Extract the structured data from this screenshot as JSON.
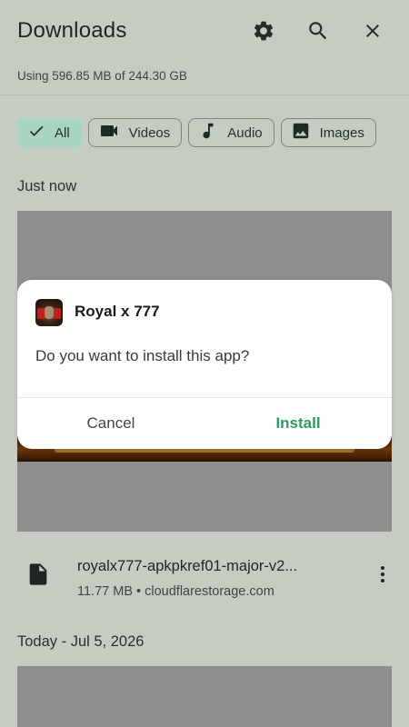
{
  "header": {
    "title": "Downloads",
    "storage_text": "Using 596.85 MB of 244.30 GB"
  },
  "filters": [
    {
      "label": "All",
      "icon": "check-icon",
      "selected": true
    },
    {
      "label": "Videos",
      "icon": "video-icon",
      "selected": false
    },
    {
      "label": "Audio",
      "icon": "music-note-icon",
      "selected": false
    },
    {
      "label": "Images",
      "icon": "image-icon",
      "selected": false
    }
  ],
  "sections": [
    {
      "heading": "Just now",
      "items": [
        {
          "name": "royalx777-apkpkref01-major-v2...",
          "meta": "11.77 MB • cloudflarestorage.com"
        }
      ]
    },
    {
      "heading": "Today - Jul 5, 2026",
      "items": []
    }
  ],
  "dialog": {
    "app_name": "Royal x 777",
    "question": "Do you want to install this app?",
    "cancel_label": "Cancel",
    "install_label": "Install"
  },
  "colors": {
    "background": "#c5cdc2",
    "chip_selected": "#a8d4c2",
    "install_accent": "#2e9b63"
  }
}
